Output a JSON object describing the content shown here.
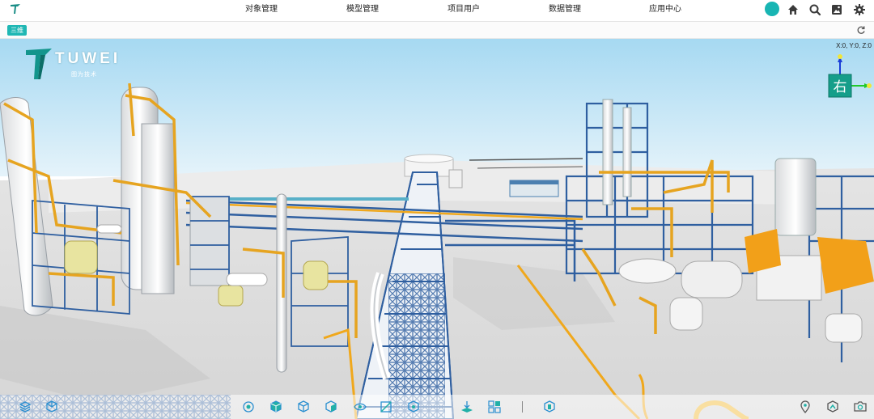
{
  "app": {
    "nav": [
      "对象管理",
      "模型管理",
      "项目用户",
      "数据管理",
      "应用中心"
    ],
    "accent_color": "#1fb7b4",
    "header_icons": [
      "home-icon",
      "search-icon",
      "screenshot-icon",
      "settings-icon"
    ]
  },
  "subbar": {
    "view_button": "三维",
    "refresh_icon": "refresh-icon"
  },
  "viewport": {
    "brand_name": "TUWEI",
    "brand_subtitle": "图为技术",
    "coordinate_readout": "X:0, Y:0, Z:0",
    "view_cube_label": "右",
    "view_cube_color": "#159e8a"
  },
  "toolbar": {
    "left_tools": [
      "layers-icon",
      "cube-frame-icon",
      "target-icon",
      "cube-solid-icon",
      "cube-outline-icon",
      "cube-half-icon",
      "hide-icon",
      "section-icon",
      "measure-icon",
      "ground-icon",
      "grid-icon"
    ],
    "middle_tools": [
      "model-icon"
    ],
    "right_tools": [
      "location-pin-icon",
      "route-icon",
      "camera-icon"
    ]
  }
}
